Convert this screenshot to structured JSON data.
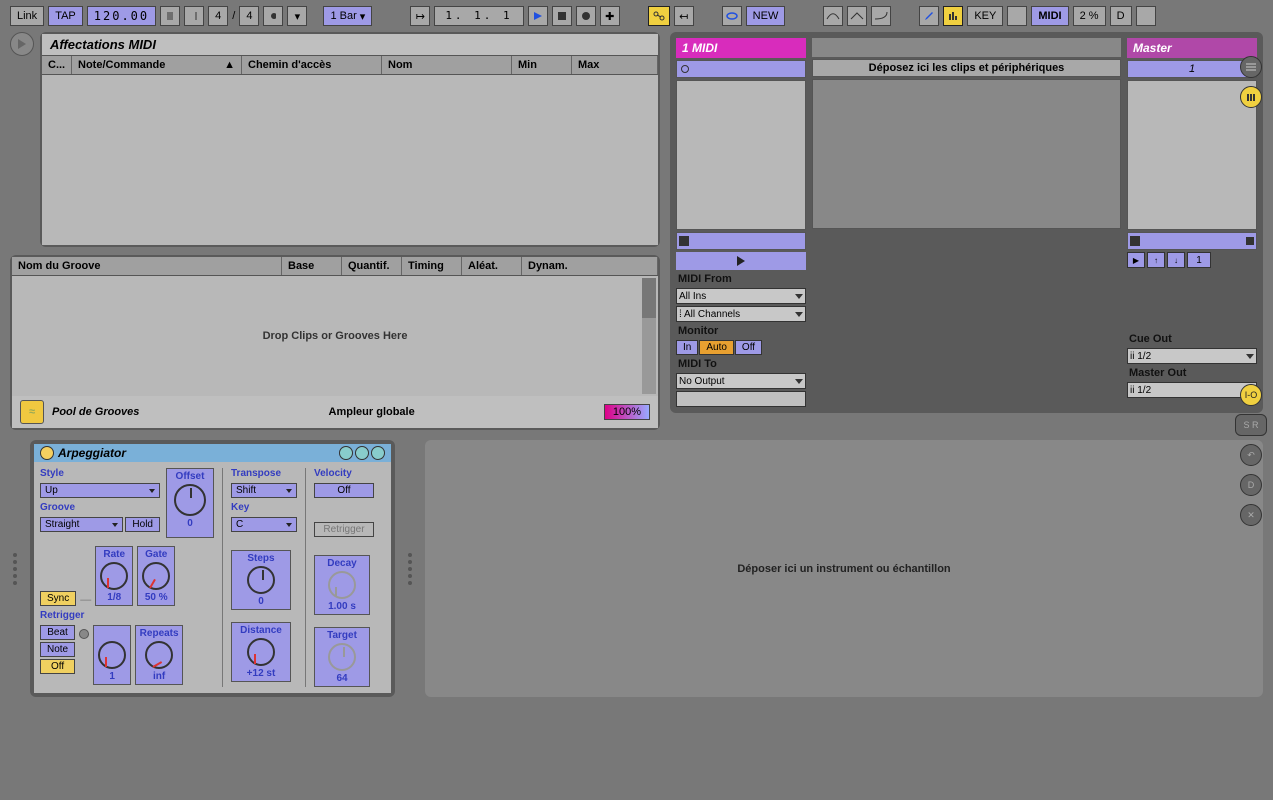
{
  "topbar": {
    "link": "Link",
    "tap": "TAP",
    "tempo": "120.00",
    "sig_num": "4",
    "sig_sep": "/",
    "sig_den": "4",
    "quantize": "1 Bar",
    "position": "1.  1.  1",
    "new": "NEW",
    "key": "KEY",
    "midi": "MIDI",
    "midi_pct": "2 %",
    "d": "D"
  },
  "midi_map": {
    "title": "Affectations MIDI",
    "cols": {
      "c": "C...",
      "note": "Note/Commande",
      "path": "Chemin d'accès",
      "name": "Nom",
      "min": "Min",
      "max": "Max"
    }
  },
  "groove": {
    "cols": {
      "name": "Nom du Groove",
      "base": "Base",
      "quant": "Quantif.",
      "timing": "Timing",
      "aleat": "Aléat.",
      "dynam": "Dynam."
    },
    "drop": "Drop Clips or Grooves Here",
    "footer": "Pool de Grooves",
    "amp_label": "Ampleur globale",
    "amp_value": "100%"
  },
  "session": {
    "track1": "1 MIDI",
    "drop_msg": "Déposez ici les clips et périphériques",
    "master": "Master",
    "master_scene_1": "1",
    "io": {
      "midi_from": "MIDI From",
      "all_ins": "All Ins",
      "all_channels": "All Channels",
      "icon_prefix": "⁞",
      "monitor": "Monitor",
      "mon_in": "In",
      "mon_auto": "Auto",
      "mon_off": "Off",
      "midi_to": "MIDI To",
      "no_output": "No Output",
      "cue_out": "Cue Out",
      "cue_val": "1/2",
      "master_out": "Master Out",
      "master_val": "1/2",
      "io_prefix": "ii"
    },
    "master_nav_num": "1"
  },
  "device": {
    "title": "Arpeggiator",
    "labels": {
      "style": "Style",
      "offset": "Offset",
      "transpose": "Transpose",
      "velocity": "Velocity",
      "groove": "Groove",
      "key": "Key",
      "rate": "Rate",
      "gate": "Gate",
      "steps": "Steps",
      "decay": "Decay",
      "retrigger": "Retrigger",
      "repeats": "Repeats",
      "distance": "Distance",
      "target": "Target"
    },
    "vals": {
      "style": "Up",
      "transpose": "Shift",
      "velocity_off": "Off",
      "groove": "Straight",
      "hold": "Hold",
      "key": "C",
      "retrig_btn": "Retrigger",
      "sync": "Sync",
      "rate": "1/8",
      "gate": "50 %",
      "steps": "0",
      "decay": "1.00 s",
      "ret_beat": "Beat",
      "ret_note": "Note",
      "ret_off": "Off",
      "repeats_num": "1",
      "repeats_inf": "inf",
      "distance": "+12 st",
      "target": "64",
      "offset": "0"
    }
  },
  "drop_instrument": "Déposer ici un instrument ou échantillon",
  "side": {
    "io": "I-O",
    "s": "S",
    "r": "R",
    "back": "↶",
    "d": "D",
    "x": "✕"
  }
}
